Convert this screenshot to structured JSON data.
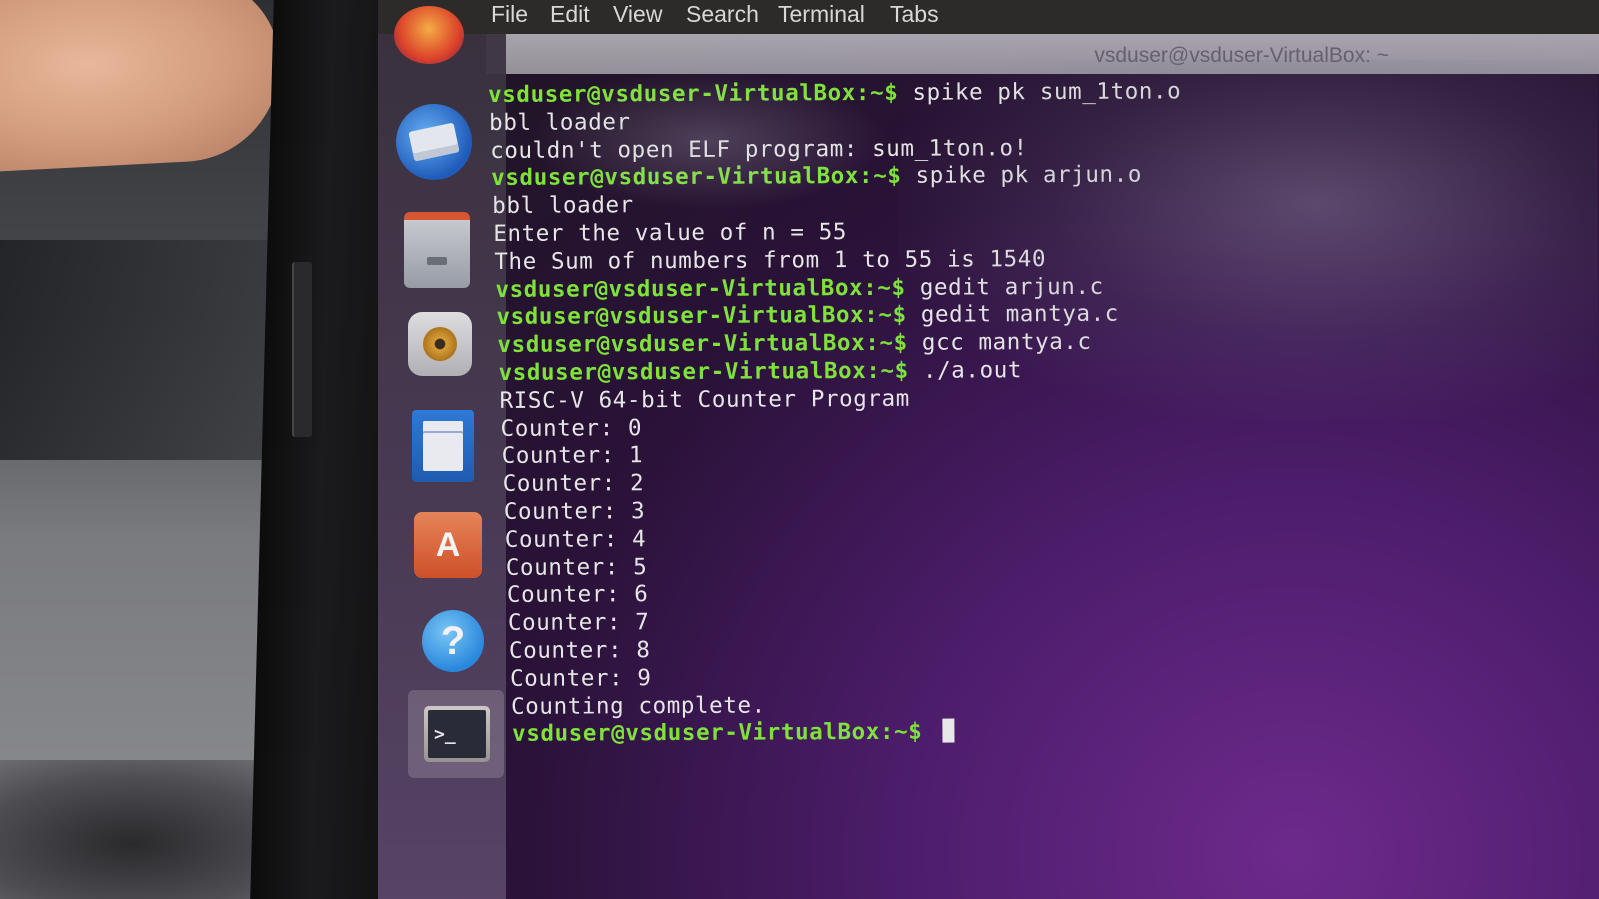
{
  "menu": {
    "items": [
      "File",
      "Edit",
      "View",
      "Search",
      "Terminal",
      "Tabs"
    ]
  },
  "window": {
    "title": "vsduser@vsduser-VirtualBox: ~"
  },
  "launcher": {
    "icons": [
      "firefox-icon",
      "thunderbird-icon",
      "files-icon",
      "rhythmbox-icon",
      "writer-icon",
      "software-center-icon",
      "help-icon",
      "terminal-icon"
    ],
    "software_letter": "A",
    "help_glyph": "?",
    "terminal_glyph": ">_"
  },
  "terminal": {
    "prompt": "vsduser@vsduser-VirtualBox:~$",
    "lines": [
      {
        "type": "cmd",
        "text": " spike pk sum_1ton.o"
      },
      {
        "type": "out",
        "text": "bbl loader"
      },
      {
        "type": "out",
        "text": "couldn't open ELF program: sum_1ton.o!"
      },
      {
        "type": "cmd",
        "text": " spike pk arjun.o"
      },
      {
        "type": "out",
        "text": "bbl loader"
      },
      {
        "type": "out",
        "text": "Enter the value of n = 55"
      },
      {
        "type": "out",
        "text": "The Sum of numbers from 1 to 55 is 1540"
      },
      {
        "type": "cmd",
        "text": " gedit arjun.c"
      },
      {
        "type": "cmd",
        "text": " gedit mantya.c"
      },
      {
        "type": "cmd",
        "text": " gcc mantya.c"
      },
      {
        "type": "cmd",
        "text": " ./a.out"
      },
      {
        "type": "out",
        "text": "RISC-V 64-bit Counter Program"
      },
      {
        "type": "out",
        "text": "Counter: 0"
      },
      {
        "type": "out",
        "text": "Counter: 1"
      },
      {
        "type": "out",
        "text": "Counter: 2"
      },
      {
        "type": "out",
        "text": "Counter: 3"
      },
      {
        "type": "out",
        "text": "Counter: 4"
      },
      {
        "type": "out",
        "text": "Counter: 5"
      },
      {
        "type": "out",
        "text": "Counter: 6"
      },
      {
        "type": "out",
        "text": "Counter: 7"
      },
      {
        "type": "out",
        "text": "Counter: 8"
      },
      {
        "type": "out",
        "text": "Counter: 9"
      },
      {
        "type": "out",
        "text": "Counting complete."
      },
      {
        "type": "cmd",
        "text": " "
      }
    ]
  },
  "colors": {
    "prompt": "#7ee23a",
    "output": "#e6e6e6"
  }
}
